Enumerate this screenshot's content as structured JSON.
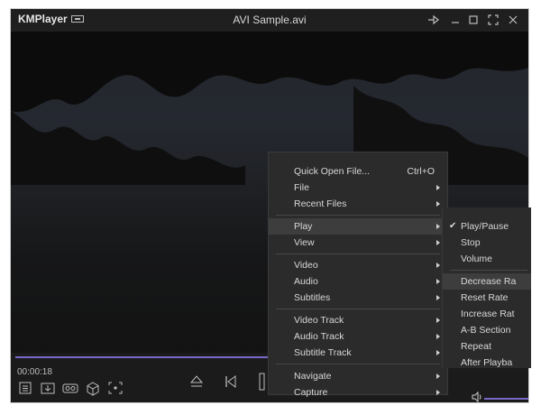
{
  "app": {
    "name": "KMPlayer",
    "file_title": "AVI Sample.avi"
  },
  "playback": {
    "time": "00:00:18"
  },
  "context_menu": {
    "items": [
      {
        "label": "Quick Open File...",
        "shortcut": "Ctrl+O"
      },
      {
        "label": "File"
      },
      {
        "label": "Recent Files"
      },
      {
        "label": "Play"
      },
      {
        "label": "View"
      },
      {
        "label": "Video"
      },
      {
        "label": "Audio"
      },
      {
        "label": "Subtitles"
      },
      {
        "label": "Video Track"
      },
      {
        "label": "Audio Track"
      },
      {
        "label": "Subtitle Track"
      },
      {
        "label": "Navigate"
      },
      {
        "label": "Capture"
      }
    ]
  },
  "play_submenu": {
    "items": [
      {
        "label": "Play/Pause"
      },
      {
        "label": "Stop"
      },
      {
        "label": "Volume"
      },
      {
        "label": "Decrease Ra"
      },
      {
        "label": "Reset Rate"
      },
      {
        "label": "Increase Rat"
      },
      {
        "label": "A-B Section"
      },
      {
        "label": "Repeat"
      },
      {
        "label": "After Playba"
      }
    ]
  },
  "colors": {
    "accent": "#7a68c8",
    "menu_bg": "#2b2b2b",
    "menu_highlight": "#3d3d3d"
  },
  "icons": [
    "minimize-icon",
    "maximize-icon",
    "fullscreen-icon",
    "close-icon",
    "pin-icon",
    "playlist-icon",
    "download-icon",
    "vr-icon",
    "3d-icon",
    "capture-icon",
    "eject-icon",
    "previous-icon",
    "pause-icon",
    "volume-icon"
  ]
}
